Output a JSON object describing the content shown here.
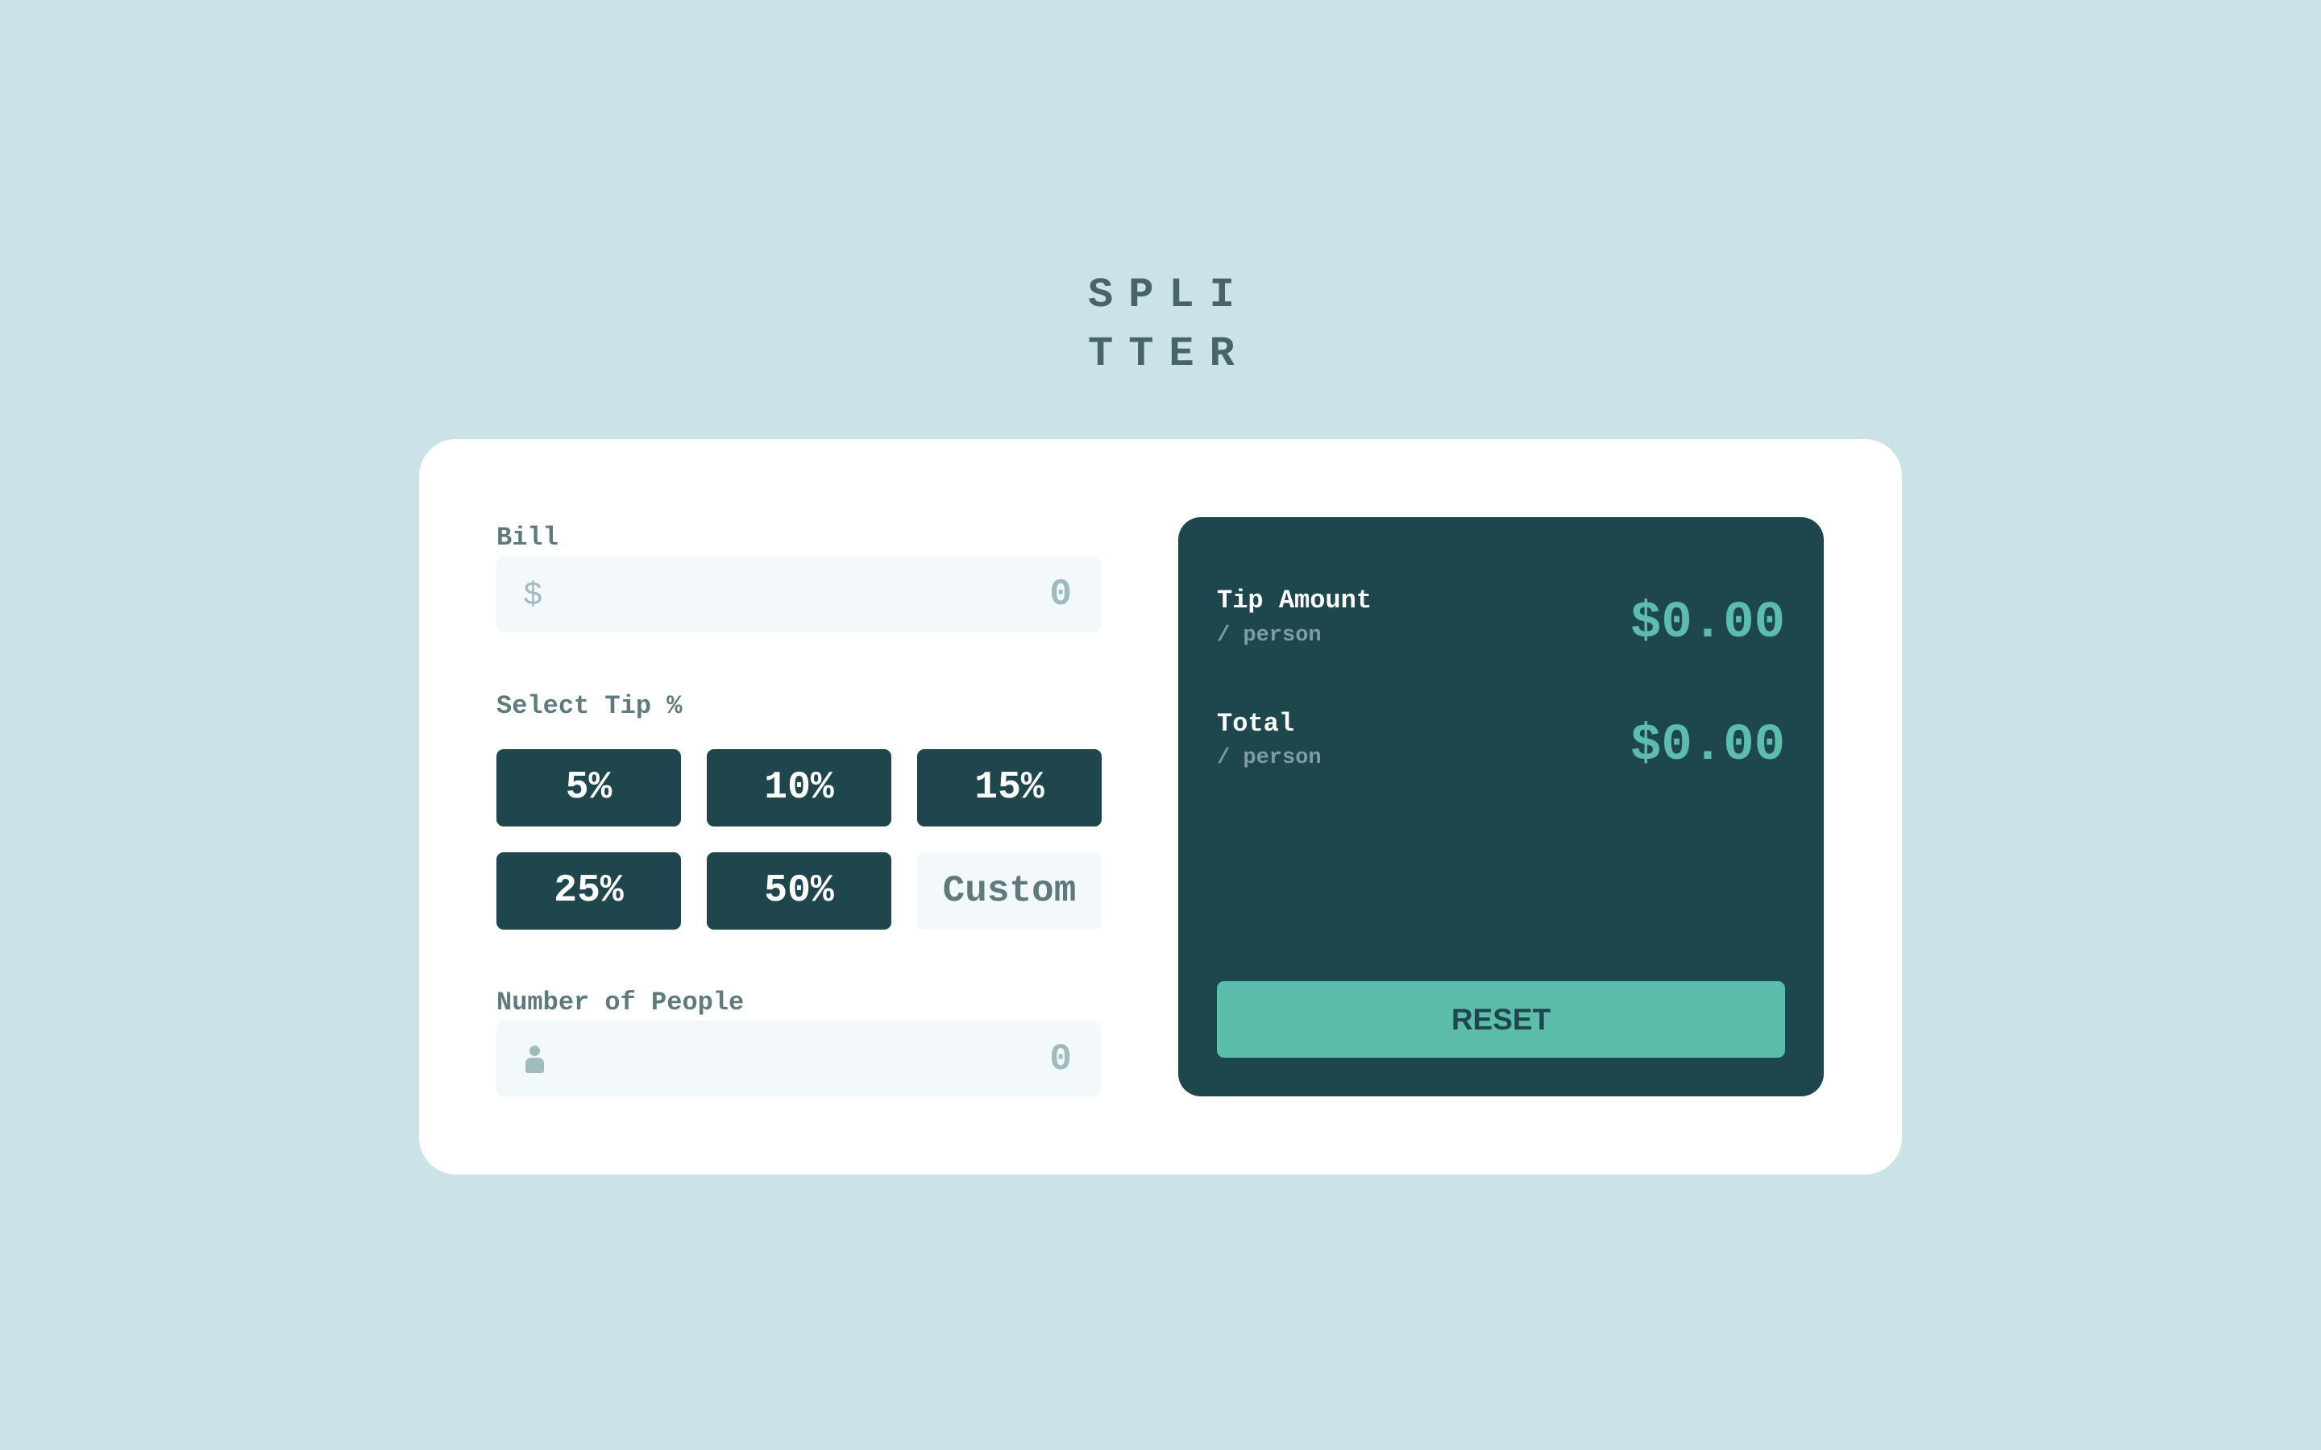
{
  "logo": {
    "line1": "SPLI",
    "line2": "TTER"
  },
  "bill": {
    "label": "Bill",
    "icon": "dollar-icon",
    "icon_glyph": "$",
    "value": "",
    "placeholder": "0"
  },
  "tip": {
    "label": "Select Tip %",
    "options": [
      {
        "label": "5%",
        "value": 5
      },
      {
        "label": "10%",
        "value": 10
      },
      {
        "label": "15%",
        "value": 15
      },
      {
        "label": "25%",
        "value": 25
      },
      {
        "label": "50%",
        "value": 50
      }
    ],
    "custom_placeholder": "Custom"
  },
  "people": {
    "label": "Number of People",
    "icon": "person-icon",
    "value": "",
    "placeholder": "0"
  },
  "results": {
    "tip_amount": {
      "title": "Tip Amount",
      "subtitle": "/ person",
      "value": "$0.00"
    },
    "total": {
      "title": "Total",
      "subtitle": "/ person",
      "value": "$0.00"
    },
    "reset_label": "RESET"
  },
  "colors": {
    "background": "#cbe3e7",
    "card": "#ffffff",
    "dark_green": "#1e474d",
    "accent": "#5dbdab",
    "label_grey": "#5e7a7d",
    "placeholder_grey": "#9ebbbd",
    "input_bg": "#f3f8fb"
  }
}
